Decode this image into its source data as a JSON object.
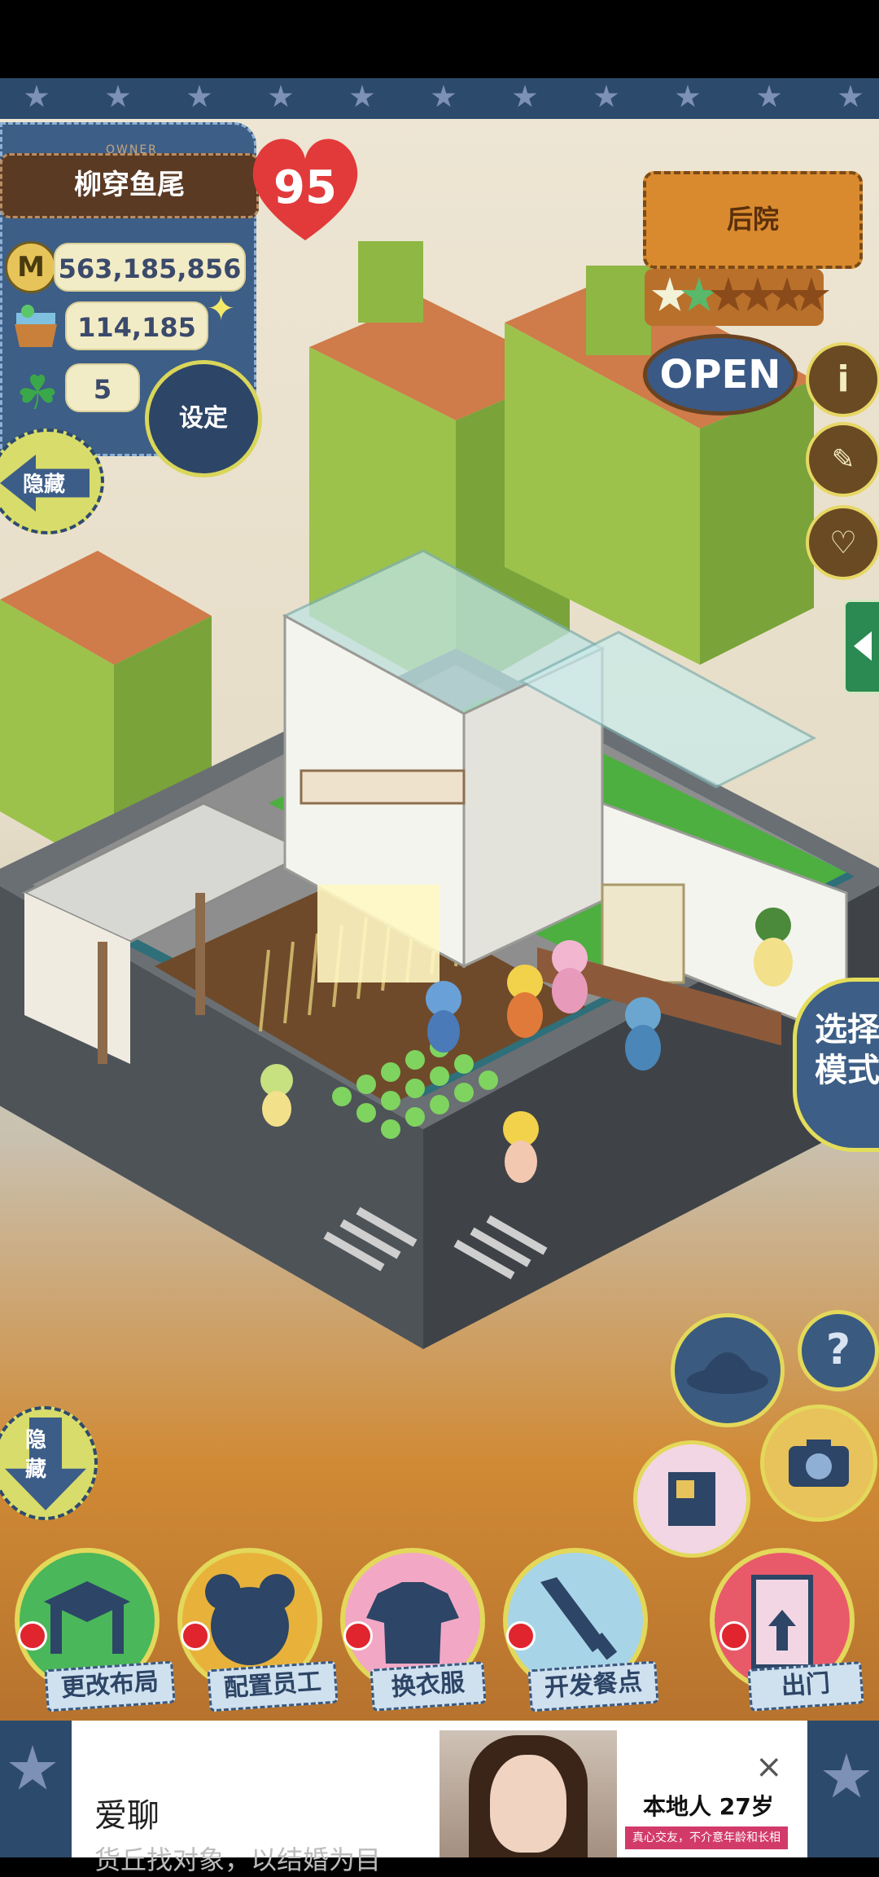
{
  "owner": {
    "caption": "OWNER",
    "name": "柳穿鱼尾"
  },
  "hearts": "95",
  "stats": {
    "coins": "563,185,856",
    "coin_symbol": "M",
    "goods": "114,185",
    "clovers": "5"
  },
  "buttons": {
    "settings": "设定",
    "hide_top": "隐藏",
    "hide_bottom": "隐藏",
    "mode_line1": "选择",
    "mode_line2": "模式",
    "help": "?",
    "info": "i"
  },
  "sign": {
    "title": "后院",
    "open": "OPEN",
    "stars_filled": 2,
    "stars_total": 6
  },
  "menu": [
    {
      "label": "更改布局",
      "color": "#4ab75a"
    },
    {
      "label": "配置员工",
      "color": "#e8b23a"
    },
    {
      "label": "换衣服",
      "color": "#f2a8c4"
    },
    {
      "label": "开发餐点",
      "color": "#a8d4e8"
    },
    {
      "label": "出门",
      "color": "#e85a6a"
    }
  ],
  "ad": {
    "title": "爱聊",
    "subtitle": "货丘找对象，以结婚为目",
    "local": "本地人  27岁",
    "tag": "真心交友，不介意年龄和长相",
    "close": "×"
  }
}
